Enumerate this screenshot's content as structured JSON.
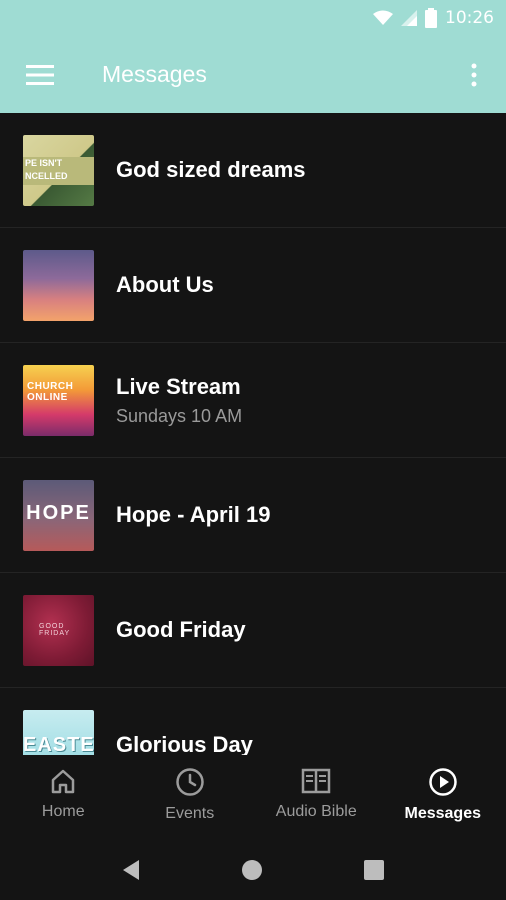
{
  "status_bar": {
    "time": "10:26"
  },
  "app_bar": {
    "title": "Messages"
  },
  "messages": [
    {
      "title": "God sized dreams",
      "subtitle": "",
      "thumb_text": "PE ISN'T NCELLED"
    },
    {
      "title": "About Us",
      "subtitle": "",
      "thumb_text": ""
    },
    {
      "title": "Live Stream",
      "subtitle": "Sundays 10 AM",
      "thumb_text": "CHURCH ONLINE"
    },
    {
      "title": "Hope - April 19",
      "subtitle": "",
      "thumb_text": "HOPE"
    },
    {
      "title": "Good Friday",
      "subtitle": "",
      "thumb_text": "GOOD FRIDAY"
    },
    {
      "title": "Glorious Day",
      "subtitle": "",
      "thumb_text": "EASTER"
    }
  ],
  "bottom_nav": {
    "items": [
      {
        "label": "Home",
        "icon": "home-icon"
      },
      {
        "label": "Events",
        "icon": "clock-icon"
      },
      {
        "label": "Audio Bible",
        "icon": "book-icon"
      },
      {
        "label": "Messages",
        "icon": "play-circle-icon"
      }
    ],
    "active": "Messages"
  },
  "colors": {
    "app_bar": "#9fdcd3",
    "background": "#141414",
    "secondary_text": "#9a9a9a"
  }
}
